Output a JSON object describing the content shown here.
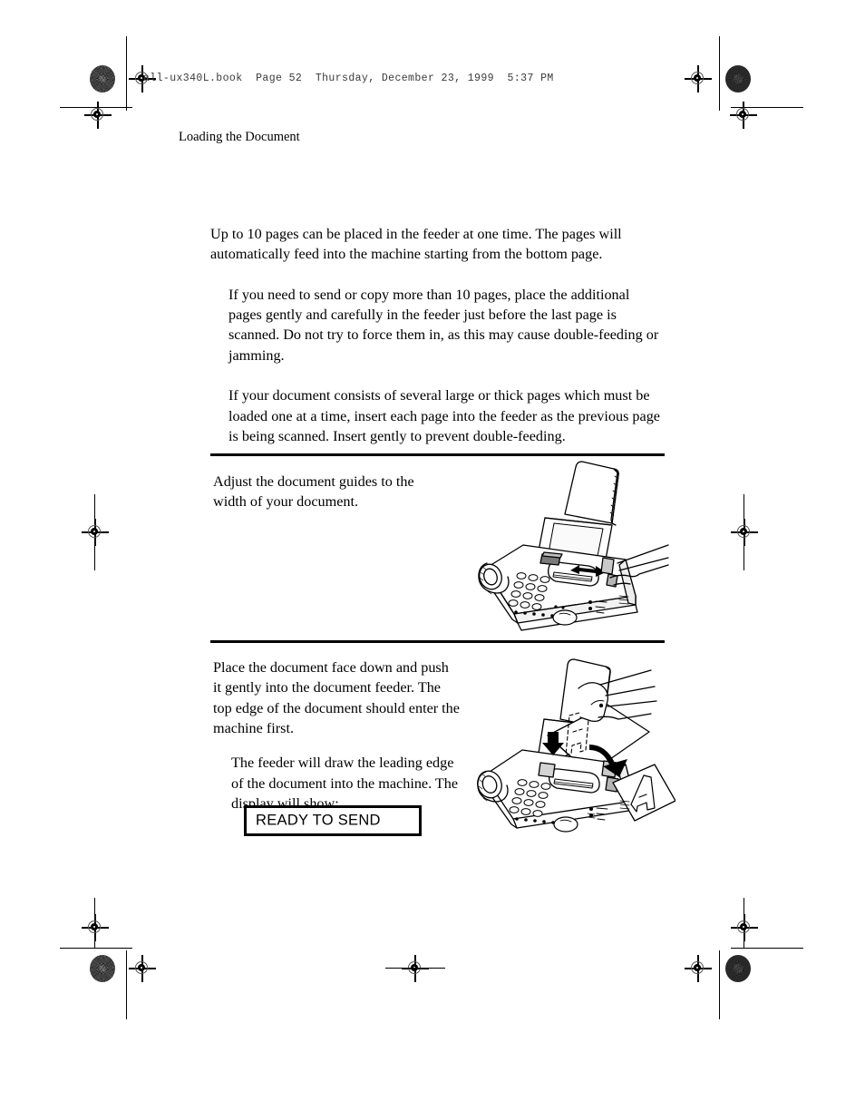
{
  "page": {
    "file_header": "all-ux340L.book  Page 52  Thursday, December 23, 1999  5:37 PM",
    "running_header": "Loading the Document",
    "page_number": "52"
  },
  "body": {
    "paragraphs": [
      "Up to 10 pages can be placed in the feeder at one time. The pages will automatically feed into the machine starting from the bottom page.",
      "If you need to send or copy more than 10 pages, place the additional pages gently and carefully in the feeder just before the last page is scanned. Do not try to force them in, as this may cause double-feeding or jamming.",
      "If your document consists of several large or thick pages which must be loaded one at a time, insert each page into the feeder as the previous page is being scanned. Insert gently to prevent double-feeding."
    ]
  },
  "steps": [
    {
      "text": "Adjust the document guides to the width of your document.",
      "illustration_label": "fax-machine-adjust-guides"
    },
    {
      "text": "Place the document face down and push it gently into the document feeder. The top edge of the document should enter the machine first.",
      "sub_text": "The feeder will draw the leading edge of the document into the machine. The display will show:",
      "illustration_label": "fax-machine-insert-document"
    }
  ],
  "display": {
    "message": "READY TO SEND"
  },
  "colors": {
    "ink": "#000000",
    "paper": "#ffffff",
    "header_gray": "#3a3a3a"
  }
}
